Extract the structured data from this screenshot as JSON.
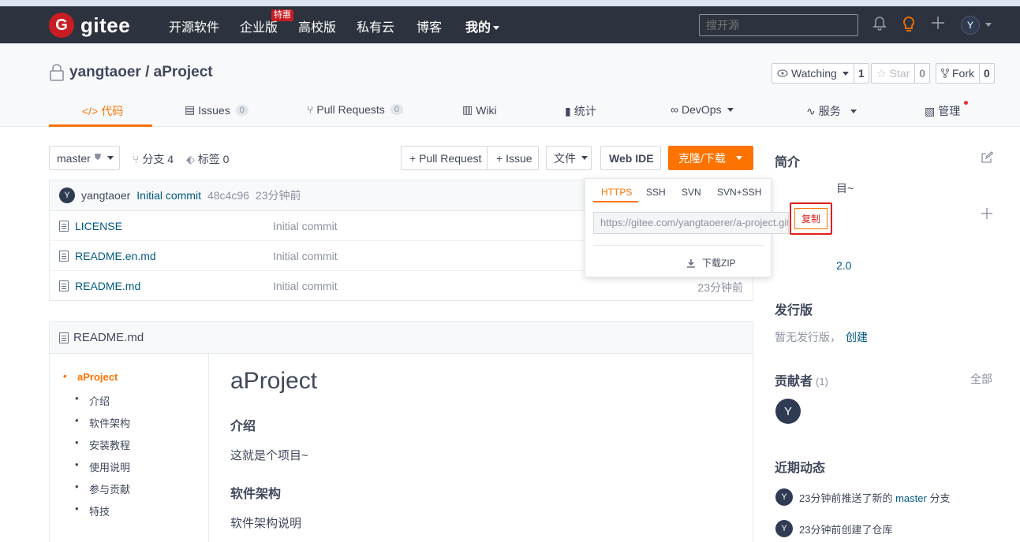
{
  "nav": {
    "logo_letter": "G",
    "logo_text": "gitee",
    "links": [
      "开源软件",
      "企业版",
      "高校版",
      "私有云",
      "博客",
      "我的"
    ],
    "special_badge": "特惠",
    "search_placeholder": "搜开源",
    "avatar": "Y"
  },
  "repo": {
    "title": "yangtaoer / aProject",
    "watch_label": "Watching",
    "watch_count": "1",
    "star_label": "Star",
    "star_count": "0",
    "fork_label": "Fork",
    "fork_count": "0"
  },
  "tabs": [
    {
      "label": "代码",
      "icon": "code-icon"
    },
    {
      "label": "Issues",
      "count": "0"
    },
    {
      "label": "Pull Requests",
      "count": "0"
    },
    {
      "label": "Wiki"
    },
    {
      "label": "统计"
    },
    {
      "label": "DevOps"
    },
    {
      "label": "服务"
    },
    {
      "label": "管理"
    }
  ],
  "toolbar": {
    "branch": "master",
    "branches": "分支 4",
    "tags": "标签 0",
    "pull_request": "+ Pull Request",
    "issue": "+ Issue",
    "file": "文件",
    "web_ide": "Web IDE",
    "clone": "克隆/下载"
  },
  "commit": {
    "avatar": "Y",
    "author": "yangtaoer",
    "message": "Initial commit",
    "hash": "48c4c96",
    "time": "23分钟前"
  },
  "files": [
    {
      "name": "LICENSE",
      "commit": "Initial commit",
      "time": ""
    },
    {
      "name": "README.en.md",
      "commit": "Initial commit",
      "time": ""
    },
    {
      "name": "README.md",
      "commit": "Initial commit",
      "time": "23分钟前"
    }
  ],
  "clone_dropdown": {
    "tabs": [
      "HTTPS",
      "SSH",
      "SVN",
      "SVN+SSH"
    ],
    "url": "https://gitee.com/yangtaoerer/a-project.git",
    "copy": "复制",
    "download_zip": "下载ZIP"
  },
  "readme": {
    "filename": "README.md",
    "toc": [
      "aProject",
      "介绍",
      "软件架构",
      "安装教程",
      "使用说明",
      "参与贡献",
      "特技"
    ],
    "h1": "aProject",
    "h2_intro": "介绍",
    "intro_text": "这就是个项目~",
    "h2_arch": "软件架构",
    "arch_text": "软件架构说明"
  },
  "sidebar": {
    "intro_title": "简介",
    "intro_peek": "目~",
    "license_peek": "2.0",
    "release_title": "发行版",
    "release_text": "暂无发行版，",
    "release_create": "创建",
    "contrib_title": "贡献者",
    "contrib_count": "(1)",
    "contrib_all": "全部",
    "contrib_avatar": "Y",
    "activity_title": "近期动态",
    "activity": [
      {
        "avatar": "Y",
        "prefix": "23分钟前推送了新的",
        "branch": "master",
        "suffix": "分支"
      },
      {
        "avatar": "Y",
        "text": "23分钟前创建了仓库"
      }
    ]
  }
}
